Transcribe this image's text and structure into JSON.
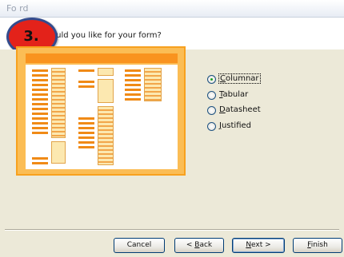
{
  "window": {
    "title_visible": "Fo      rd"
  },
  "header": {
    "step_badge": "3.",
    "question": "ould you like for your form?"
  },
  "layouts": {
    "selected": "Columnar",
    "options": [
      {
        "label": "Columnar",
        "mnemonic": "C",
        "rest": "olumnar",
        "checked": true
      },
      {
        "label": "Tabular",
        "mnemonic": "T",
        "rest": "abular",
        "checked": false
      },
      {
        "label": "Datasheet",
        "mnemonic": "D",
        "rest": "atasheet",
        "checked": false
      },
      {
        "label": "Justified",
        "mnemonic": "J",
        "rest": "ustified",
        "checked": false
      }
    ]
  },
  "buttons": {
    "cancel": "Cancel",
    "back": {
      "prefix": "< ",
      "mnemonic": "B",
      "rest": "ack"
    },
    "next": {
      "mnemonic": "N",
      "rest": "ext >"
    },
    "finish": {
      "mnemonic": "F",
      "rest": "inish"
    }
  },
  "colors": {
    "preview_border": "#f7a11f",
    "preview_fill": "#fbbd55",
    "step_badge": "#e3221a",
    "step_ring": "#324b8e"
  }
}
